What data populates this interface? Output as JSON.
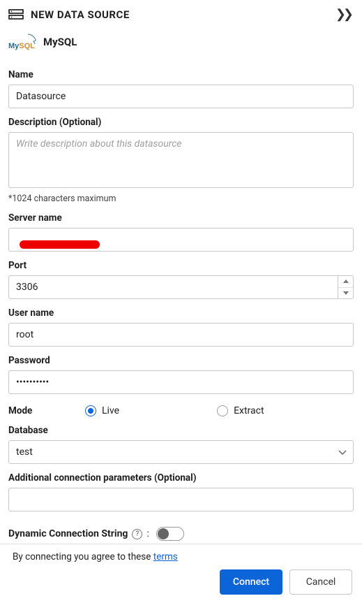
{
  "header": {
    "title": "NEW DATA SOURCE"
  },
  "datasource_type": {
    "label": "MySQL"
  },
  "form": {
    "name": {
      "label": "Name",
      "value": "Datasource"
    },
    "description": {
      "label": "Description (Optional)",
      "placeholder": "Write description about this datasource",
      "value": "",
      "helper": "*1024 characters maximum"
    },
    "server": {
      "label": "Server name",
      "value": ""
    },
    "port": {
      "label": "Port",
      "value": "3306"
    },
    "username": {
      "label": "User name",
      "value": "root"
    },
    "password": {
      "label": "Password",
      "value": "••••••••••"
    },
    "mode": {
      "label": "Mode",
      "selected": "live",
      "options": {
        "live": "Live",
        "extract": "Extract"
      }
    },
    "database": {
      "label": "Database",
      "value": "test"
    },
    "additional": {
      "label": "Additional connection parameters (Optional)",
      "value": ""
    },
    "dynamic": {
      "label": "Dynamic Connection String",
      "enabled": false
    }
  },
  "footer": {
    "agree_prefix": "By connecting you agree to these ",
    "terms_label": "terms",
    "connect_label": "Connect",
    "cancel_label": "Cancel"
  }
}
